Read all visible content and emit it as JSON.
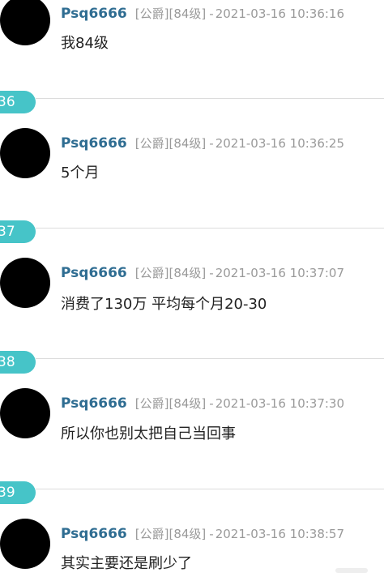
{
  "posts": [
    {
      "username": "Psq6666",
      "tag1": "[公爵]",
      "tag2": "[84级]",
      "dash": "-",
      "timestamp": "2021-03-16 10:36:16",
      "content": "我84级"
    },
    {
      "username": "Psq6666",
      "tag1": "[公爵]",
      "tag2": "[84级]",
      "dash": "-",
      "timestamp": "2021-03-16 10:36:25",
      "content": "5个月"
    },
    {
      "username": "Psq6666",
      "tag1": "[公爵]",
      "tag2": "[84级]",
      "dash": "-",
      "timestamp": "2021-03-16 10:37:07",
      "content": "消费了130万 平均每个月20-30"
    },
    {
      "username": "Psq6666",
      "tag1": "[公爵]",
      "tag2": "[84级]",
      "dash": "-",
      "timestamp": "2021-03-16 10:37:30",
      "content": "所以你也别太把自己当回事"
    },
    {
      "username": "Psq6666",
      "tag1": "[公爵]",
      "tag2": "[84级]",
      "dash": "-",
      "timestamp": "2021-03-16 10:38:57",
      "content": "其实主要还是刷少了"
    }
  ],
  "floors": [
    "36",
    "37",
    "38",
    "39"
  ],
  "colors": {
    "username": "#2f6d92",
    "meta": "#9a9a9a",
    "content": "#222222",
    "floor_badge": "#46c4c8",
    "divider": "#dcdcdc",
    "avatar": "#000000"
  }
}
